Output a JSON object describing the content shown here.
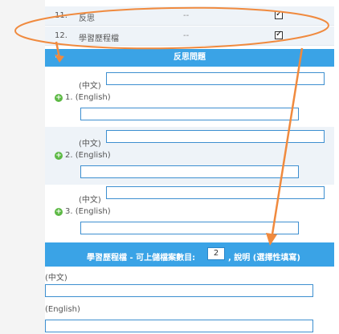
{
  "checklist": [
    {
      "num": "11.",
      "name": "反思",
      "dash": "--",
      "checked": "☑"
    },
    {
      "num": "12.",
      "name": "學習歷程檔",
      "dash": "--",
      "checked": "☑"
    }
  ],
  "reflection": {
    "header": "反思問題",
    "plus": "+",
    "questions": [
      {
        "zh_label": "(中文)",
        "number": "1.",
        "en_label": "(English)"
      },
      {
        "zh_label": "(中文)",
        "number": "2.",
        "en_label": "(English)"
      },
      {
        "zh_label": "(中文)",
        "number": "3.",
        "en_label": "(English)"
      }
    ]
  },
  "portfolio": {
    "header_prefix": "學習歷程檔 - 可上儲檔案數目:",
    "file_count": "2",
    "header_suffix": ", 說明 (選擇性填寫)",
    "zh_label": "(中文)",
    "en_label": "(English)"
  },
  "colors": {
    "header_blue": "#3aa3e6",
    "annotation_orange": "#f08a3e",
    "add_icon_green": "#5db945"
  }
}
